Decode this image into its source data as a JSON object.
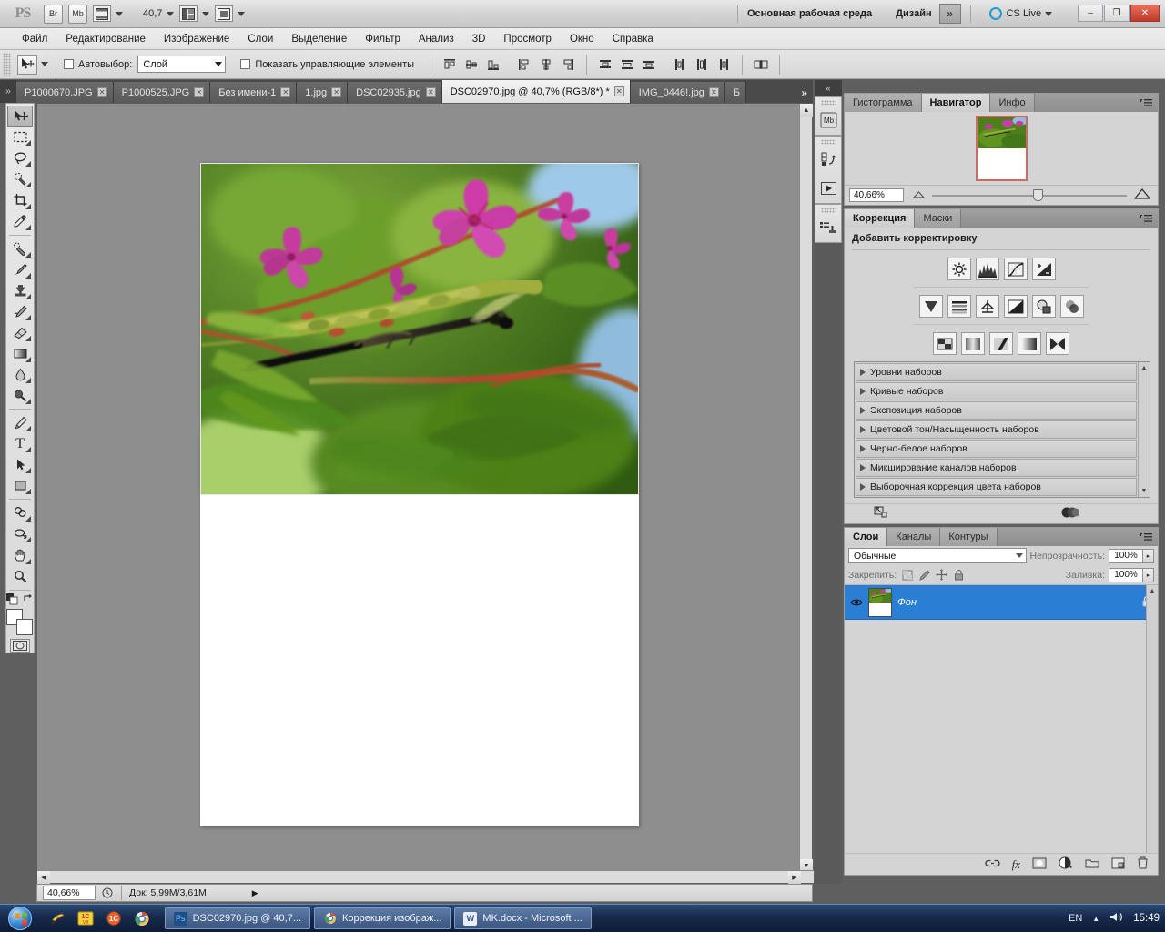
{
  "app": {
    "name": "Adobe Photoshop CS5",
    "logo_text": "PS"
  },
  "titlebar": {
    "bridge_label": "Br",
    "minibridge_label": "Mb",
    "view_extras_icon": "screen-mode-icon",
    "zoom_value": "40,7",
    "arrange_icon": "arrange-documents-icon",
    "screen_mode_icon": "screen-mode-icon",
    "workspace_primary": "Основная рабочая среда",
    "workspace_secondary": "Дизайн",
    "workspace_more": "»",
    "cslive_label": "CS Live",
    "minimize": "–",
    "restore": "❐",
    "close": "✕"
  },
  "menubar": {
    "items": [
      "Файл",
      "Редактирование",
      "Изображение",
      "Слои",
      "Выделение",
      "Фильтр",
      "Анализ",
      "3D",
      "Просмотр",
      "Окно",
      "Справка"
    ]
  },
  "optionsbar": {
    "tool_preset_icon": "move-tool-icon",
    "autoselect_label": "Автовыбор:",
    "autoselect_value": "Слой",
    "show_controls_label": "Показать управляющие элементы",
    "align_group_1": [
      "align-left-edges",
      "align-horizontal-centers",
      "align-right-edges"
    ],
    "align_group_2": [
      "align-top-edges",
      "align-vertical-centers",
      "align-bottom-edges"
    ],
    "distribute_group_1": [
      "distribute-top-edges",
      "distribute-vertical-centers",
      "distribute-bottom-edges"
    ],
    "distribute_group_2": [
      "distribute-left-edges",
      "distribute-horizontal-centers",
      "distribute-right-edges"
    ],
    "auto_align_icon": "auto-align-layers"
  },
  "tabs": {
    "items": [
      {
        "label": "P1000670.JPG",
        "active": false
      },
      {
        "label": "P1000525.JPG",
        "active": false
      },
      {
        "label": "Без имени-1",
        "active": false
      },
      {
        "label": "1.jpg",
        "active": false
      },
      {
        "label": "DSC02935.jpg",
        "active": false
      },
      {
        "label": "DSC02970.jpg @ 40,7% (RGB/8*) *",
        "active": true
      },
      {
        "label": "IMG_0446!.jpg",
        "active": false
      },
      {
        "label": "Б",
        "active": false
      }
    ],
    "overflow": "»"
  },
  "toolbox": {
    "tools": [
      {
        "name": "move-tool",
        "glyph": "➤",
        "selected": true,
        "has_flyout": false
      },
      {
        "name": "rectangular-marquee-tool",
        "glyph": "⬚",
        "selected": false,
        "has_flyout": true
      },
      {
        "name": "lasso-tool",
        "glyph": "❀",
        "selected": false,
        "has_flyout": true
      },
      {
        "name": "quick-selection-tool",
        "glyph": "✦",
        "selected": false,
        "has_flyout": true
      },
      {
        "name": "crop-tool",
        "glyph": "✠",
        "selected": false,
        "has_flyout": true
      },
      {
        "name": "eyedropper-tool",
        "glyph": "✎",
        "selected": false,
        "has_flyout": true
      },
      {
        "name": "spot-healing-brush-tool",
        "glyph": "❁",
        "selected": false,
        "has_flyout": true
      },
      {
        "name": "brush-tool",
        "glyph": "✒",
        "selected": false,
        "has_flyout": true
      },
      {
        "name": "clone-stamp-tool",
        "glyph": "⚑",
        "selected": false,
        "has_flyout": true
      },
      {
        "name": "history-brush-tool",
        "glyph": "✐",
        "selected": false,
        "has_flyout": true
      },
      {
        "name": "eraser-tool",
        "glyph": "▱",
        "selected": false,
        "has_flyout": true
      },
      {
        "name": "gradient-tool",
        "glyph": "▤",
        "selected": false,
        "has_flyout": true
      },
      {
        "name": "blur-tool",
        "glyph": "●",
        "selected": false,
        "has_flyout": true
      },
      {
        "name": "dodge-tool",
        "glyph": "◐",
        "selected": false,
        "has_flyout": true
      },
      {
        "name": "pen-tool",
        "glyph": "✑",
        "selected": false,
        "has_flyout": true
      },
      {
        "name": "horizontal-type-tool",
        "glyph": "T",
        "selected": false,
        "has_flyout": true
      },
      {
        "name": "path-selection-tool",
        "glyph": "➤",
        "selected": false,
        "has_flyout": true
      },
      {
        "name": "rectangle-tool",
        "glyph": "■",
        "selected": false,
        "has_flyout": true
      },
      {
        "name": "3d-object-rotate-tool",
        "glyph": "◔",
        "selected": false,
        "has_flyout": true
      },
      {
        "name": "3d-camera-rotate-tool",
        "glyph": "◑",
        "selected": false,
        "has_flyout": true
      },
      {
        "name": "hand-tool",
        "glyph": "✋",
        "selected": false,
        "has_flyout": true
      },
      {
        "name": "zoom-tool",
        "glyph": "⚲",
        "selected": false,
        "has_flyout": false
      }
    ],
    "foreground_color": "#ffffff",
    "background_color": "#ffffff",
    "quickmask_icon": "quick-mask-mode-icon"
  },
  "document": {
    "title": "DSC02970.jpg",
    "zoom": "40,7%",
    "mode": "RGB/8*",
    "photo_alt": "Макроснимок стрекозы на соцветиях дербенника"
  },
  "statusbar": {
    "zoom": "40,66%",
    "clock_icon": "timing-icon",
    "doc_info": "Док: 5,99М/3,61М",
    "arrow": "▶"
  },
  "dockstrip": {
    "collapse_icon": "«",
    "icons": [
      {
        "name": "mini-bridge-icon",
        "label": "Mb"
      },
      {
        "name": "history-icon",
        "label": ""
      },
      {
        "name": "actions-icon",
        "label": "▶"
      },
      {
        "name": "tool-presets-icon",
        "label": ""
      }
    ]
  },
  "navigator_panel": {
    "tabs": [
      {
        "label": "Гистограмма",
        "active": false
      },
      {
        "label": "Навигатор",
        "active": true
      },
      {
        "label": "Инфо",
        "active": false
      }
    ],
    "zoom_value": "40.66%",
    "zoom_out_icon": "zoom-out-icon",
    "zoom_in_icon": "zoom-in-icon",
    "menu_icon": "panel-menu-icon"
  },
  "adjustments_panel": {
    "tabs": [
      {
        "label": "Коррекция",
        "active": true
      },
      {
        "label": "Маски",
        "active": false
      }
    ],
    "title": "Добавить корректировку",
    "row1": [
      "brightness-contrast-icon",
      "levels-icon",
      "curves-icon",
      "exposure-icon"
    ],
    "row2": [
      "vibrance-icon",
      "hue-saturation-icon",
      "color-balance-icon",
      "black-white-icon",
      "photo-filter-icon",
      "channel-mixer-icon"
    ],
    "row3": [
      "invert-icon",
      "posterize-icon",
      "threshold-icon",
      "gradient-map-icon",
      "selective-color-icon"
    ],
    "presets": [
      "Уровни наборов",
      "Кривые наборов",
      "Экспозиция наборов",
      "Цветовой тон/Насыщенность наборов",
      "Черно-белое наборов",
      "Микширование каналов наборов",
      "Выборочная коррекция цвета наборов"
    ],
    "footer_icons": [
      "expand-panel-icon",
      "adjustment-layers-icon"
    ],
    "menu_icon": "panel-menu-icon"
  },
  "layers_panel": {
    "tabs": [
      {
        "label": "Слои",
        "active": true
      },
      {
        "label": "Каналы",
        "active": false
      },
      {
        "label": "Контуры",
        "active": false
      }
    ],
    "blend_mode": "Обычные",
    "opacity_label": "Непрозрачность:",
    "opacity_value": "100%",
    "lock_label": "Закрепить:",
    "lock_icons": [
      "lock-transparency-icon",
      "lock-image-icon",
      "lock-position-icon",
      "lock-all-icon"
    ],
    "fill_label": "Заливка:",
    "fill_value": "100%",
    "layers": [
      {
        "name": "Фон",
        "visible": true,
        "locked": true,
        "selected": true
      }
    ],
    "footer_icons": [
      "link-layers-icon",
      "layer-style-icon",
      "layer-mask-icon",
      "new-adjustment-layer-icon",
      "new-group-icon",
      "new-layer-icon",
      "delete-layer-icon"
    ],
    "menu_icon": "panel-menu-icon"
  },
  "taskbar": {
    "start_label": "Пуск",
    "quicklaunch": [
      {
        "name": "winamp-icon",
        "glyph": "♫",
        "color": "#d6b04a"
      },
      {
        "name": "1c-v8-icon",
        "glyph": "1C",
        "color": "#f6d64a"
      },
      {
        "name": "1c-enterprise-icon",
        "glyph": "1C",
        "color": "#e8632a"
      },
      {
        "name": "chrome-icon",
        "glyph": "◉",
        "color": "#d8d8d8"
      }
    ],
    "tasks": [
      {
        "label": "DSC02970.jpg @ 40,7...",
        "icon": "photoshop-icon",
        "icon_text": "Ps",
        "icon_color": "#2a7fd4",
        "active": true
      },
      {
        "label": "Коррекция изображ...",
        "icon": "chrome-icon",
        "icon_text": "◉",
        "icon_color": "#e8a33d",
        "active": false
      },
      {
        "label": "MK.docx - Microsoft ...",
        "icon": "word-icon",
        "icon_text": "W",
        "icon_color": "#2b5797",
        "active": false
      }
    ],
    "tray": {
      "language": "EN",
      "show_hidden": "▲",
      "volume_icon": "volume-icon",
      "clock": "15:49"
    }
  }
}
